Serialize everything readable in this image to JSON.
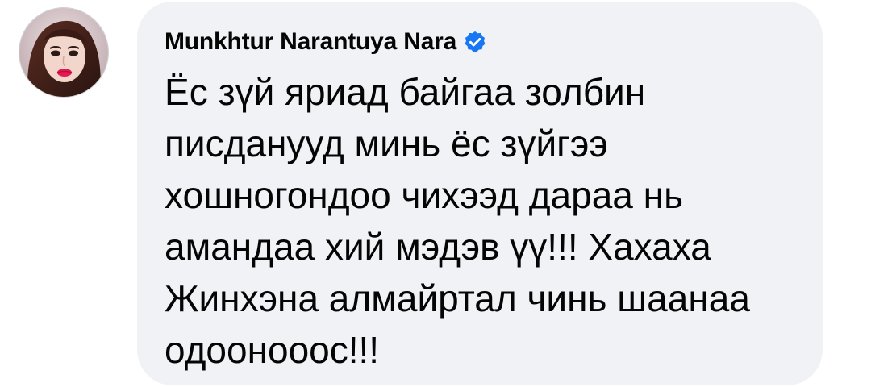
{
  "comment": {
    "author": {
      "name": "Munkhtur Narantuya Nara",
      "verified_icon": "verified-badge-icon",
      "avatar": "profile-photo"
    },
    "lines": [
      "Ёс зүй яриад байгаа золбин",
      "писданууд минь ёс зүйгээ",
      "хошногондоо чихээд дараа нь",
      "амандаа хий мэдэв үү!!! Хахаха",
      "Жинхэна алмайртал чинь шаанаа",
      "одоонооос!!!"
    ]
  },
  "colors": {
    "bubble_bg": "#f0f2f5",
    "text": "#050505",
    "verified_blue": "#1877f2"
  }
}
